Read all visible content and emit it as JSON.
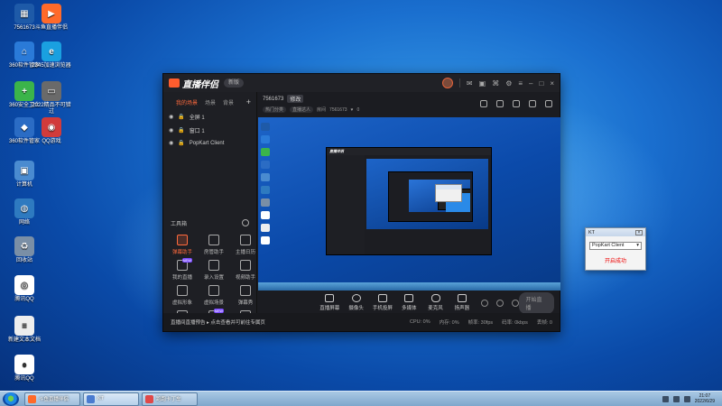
{
  "desktop": {
    "icons": [
      {
        "name": "app-7561673-icon",
        "label": "7561673",
        "color": "#1e5aa8",
        "glyph": "▦"
      },
      {
        "name": "shortcut-livestream-icon",
        "label": "斗鱼直播伴侣",
        "color": "#ff6a2a",
        "glyph": "▶"
      },
      {
        "name": "360-software-icon",
        "label": "360软件管家",
        "color": "#2a7ad8",
        "glyph": "⌂"
      },
      {
        "name": "ie-browser-icon",
        "label": "2345加速浏览器",
        "color": "#1aa0e0",
        "glyph": "e"
      },
      {
        "name": "360-security-icon",
        "label": "360安全卫士",
        "color": "#3bb44a",
        "glyph": "+"
      },
      {
        "name": "driver-icon",
        "label": "2022精品不可错过",
        "color": "#6a6a6a",
        "glyph": "▭"
      },
      {
        "name": "360-manager-icon",
        "label": "360软件管家",
        "color": "#2b6cc4",
        "glyph": "◆"
      },
      {
        "name": "game-icon",
        "label": "QQ游戏",
        "color": "#d13b3b",
        "glyph": "◉"
      },
      {
        "name": "computer-icon",
        "label": "计算机",
        "color": "#4a8bd0",
        "glyph": "▣"
      },
      {
        "name": "network-icon",
        "label": "网络",
        "color": "#2e7ac0",
        "glyph": "◍"
      },
      {
        "name": "recycle-bin-icon",
        "label": "回收站",
        "color": "#7a8fa6",
        "glyph": "♻"
      },
      {
        "name": "qq-game-icon",
        "label": "腾讯QQ",
        "color": "#ffffff",
        "glyph": "◎"
      },
      {
        "name": "text-file-icon",
        "label": "新建文本文档",
        "color": "#eeeeee",
        "glyph": "≡"
      },
      {
        "name": "qq-icon",
        "label": "腾讯QQ",
        "color": "#ffffff",
        "glyph": "●"
      }
    ]
  },
  "app": {
    "title": "直播伴侣",
    "version": "新版",
    "tabs": [
      "我的场景",
      "场景",
      "背景"
    ],
    "sources": [
      "全屏 1",
      "窗口 1",
      "PopKart Client"
    ],
    "tools_title": "工具箱",
    "tools": [
      {
        "label": "弹幕助手",
        "hot": true,
        "badge": ""
      },
      {
        "label": "房管助手",
        "hot": false,
        "badge": ""
      },
      {
        "label": "主播日历",
        "hot": false,
        "badge": ""
      },
      {
        "label": "我的直播",
        "hot": false,
        "badge": "NEW"
      },
      {
        "label": "录入设置",
        "hot": false,
        "badge": ""
      },
      {
        "label": "视频助手",
        "hot": false,
        "badge": ""
      },
      {
        "label": "虚拟形象",
        "hot": false,
        "badge": ""
      },
      {
        "label": "虚拟场景",
        "hot": false,
        "badge": ""
      },
      {
        "label": "弹幕秀",
        "hot": false,
        "badge": ""
      },
      {
        "label": "",
        "hot": false,
        "badge": ""
      },
      {
        "label": "",
        "hot": false,
        "badge": "NEW"
      },
      {
        "label": "",
        "hot": false,
        "badge": ""
      }
    ],
    "room": {
      "name": "7561673",
      "edit": "修改",
      "category": "热门分类",
      "host": "直播达人",
      "room_id_label": "房间",
      "room_id": "7561673",
      "fans": "0"
    },
    "controls": [
      "直播屏幕",
      "摄像头",
      "手机投屏",
      "多媒体",
      "麦克风",
      "扬声器"
    ],
    "go_live": "开始直播",
    "notice": "直播间直播预告 ▸ 点击查看并可前往专属页",
    "stats": [
      "CPU: 0%",
      "内存: 0%",
      "帧率: 30fps",
      "码率: 0kbps",
      "丢帧: 0"
    ]
  },
  "dialog": {
    "title": "KT",
    "selected": "PopKart Client",
    "status": "开启成功"
  },
  "taskbar": {
    "items": [
      {
        "label": "斗鱼直播伴侣",
        "color": "#ff6a2a",
        "active": false
      },
      {
        "label": "KT",
        "color": "#4a7bd0",
        "active": true
      },
      {
        "label": "跑跑卡丁车",
        "color": "#e04848",
        "active": false
      }
    ],
    "time": "21:07",
    "date": "2022/6/29"
  }
}
